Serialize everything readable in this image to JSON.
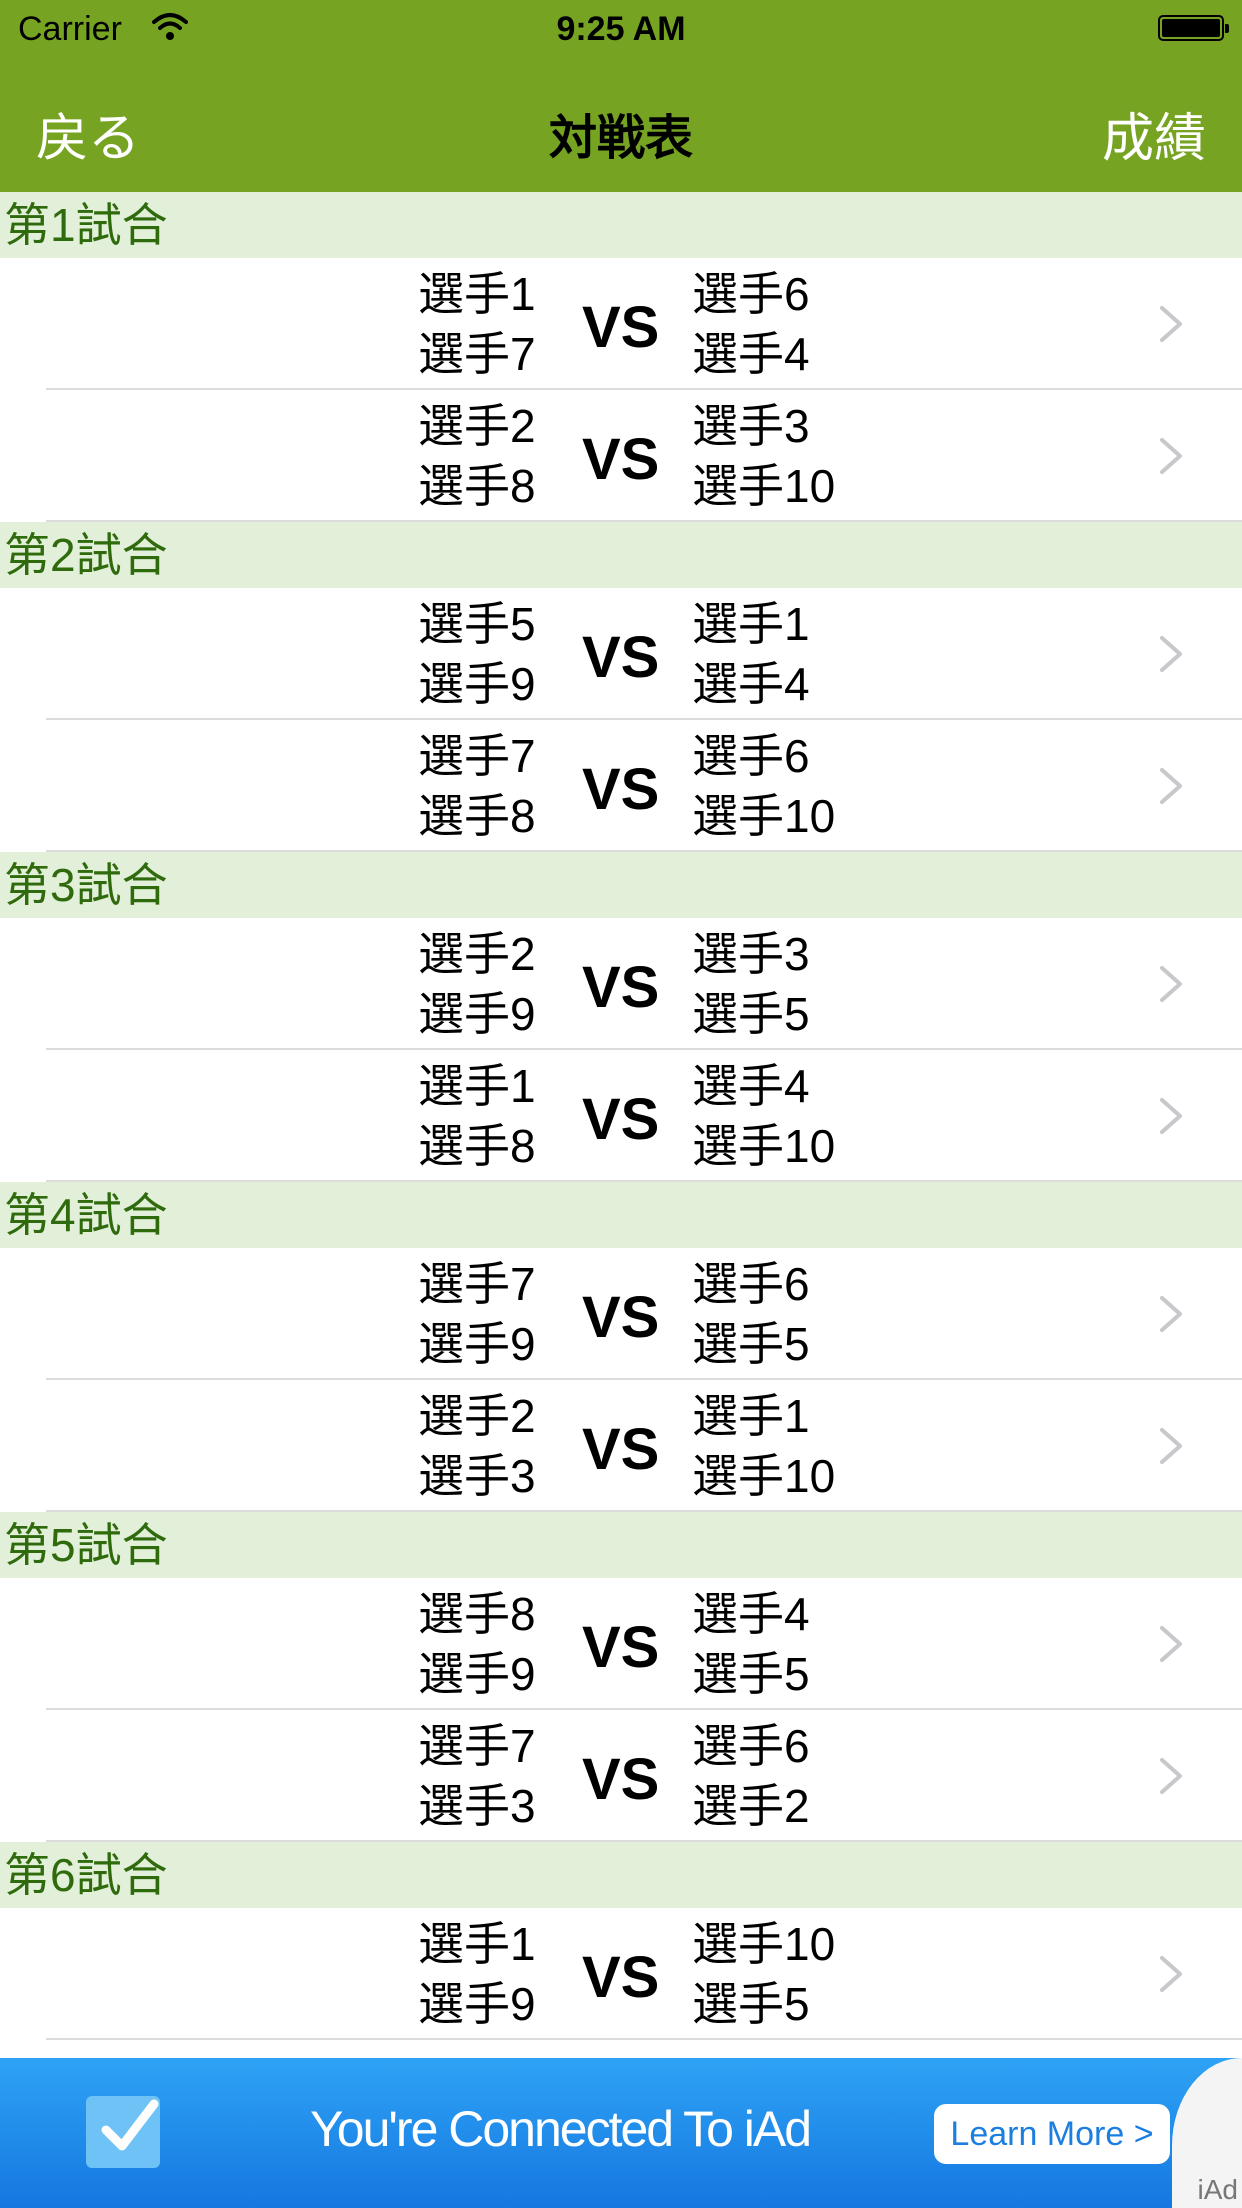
{
  "status_bar": {
    "carrier": "Carrier",
    "time": "9:25 AM"
  },
  "nav": {
    "back_label": "戻る",
    "title": "対戦表",
    "right_label": "成績"
  },
  "vs_label": "VS",
  "sections": [
    {
      "title": "第1試合",
      "matches": [
        {
          "left": [
            "選手1",
            "選手7"
          ],
          "right": [
            "選手6",
            "選手4"
          ]
        },
        {
          "left": [
            "選手2",
            "選手8"
          ],
          "right": [
            "選手3",
            "選手10"
          ]
        }
      ]
    },
    {
      "title": "第2試合",
      "matches": [
        {
          "left": [
            "選手5",
            "選手9"
          ],
          "right": [
            "選手1",
            "選手4"
          ]
        },
        {
          "left": [
            "選手7",
            "選手8"
          ],
          "right": [
            "選手6",
            "選手10"
          ]
        }
      ]
    },
    {
      "title": "第3試合",
      "matches": [
        {
          "left": [
            "選手2",
            "選手9"
          ],
          "right": [
            "選手3",
            "選手5"
          ]
        },
        {
          "left": [
            "選手1",
            "選手8"
          ],
          "right": [
            "選手4",
            "選手10"
          ]
        }
      ]
    },
    {
      "title": "第4試合",
      "matches": [
        {
          "left": [
            "選手7",
            "選手9"
          ],
          "right": [
            "選手6",
            "選手5"
          ]
        },
        {
          "left": [
            "選手2",
            "選手3"
          ],
          "right": [
            "選手1",
            "選手10"
          ]
        }
      ]
    },
    {
      "title": "第5試合",
      "matches": [
        {
          "left": [
            "選手8",
            "選手9"
          ],
          "right": [
            "選手4",
            "選手5"
          ]
        },
        {
          "left": [
            "選手7",
            "選手3"
          ],
          "right": [
            "選手6",
            "選手2"
          ]
        }
      ]
    },
    {
      "title": "第6試合",
      "matches": [
        {
          "left": [
            "選手1",
            "選手9"
          ],
          "right": [
            "選手10",
            "選手5"
          ]
        }
      ]
    }
  ],
  "ad": {
    "text": "You're Connected To iAd",
    "button": "Learn More >",
    "label": "iAd"
  },
  "icons": {
    "wifi": "wifi-icon",
    "battery": "battery-icon",
    "chevron": "chevron-right-icon",
    "ad_check": "checkmark-icon"
  },
  "colors": {
    "nav_bar": "#76a422",
    "section_header_bg": "#e2efd9",
    "section_header_text": "#2f6b0d",
    "ad_banner": "#1a85e8"
  }
}
